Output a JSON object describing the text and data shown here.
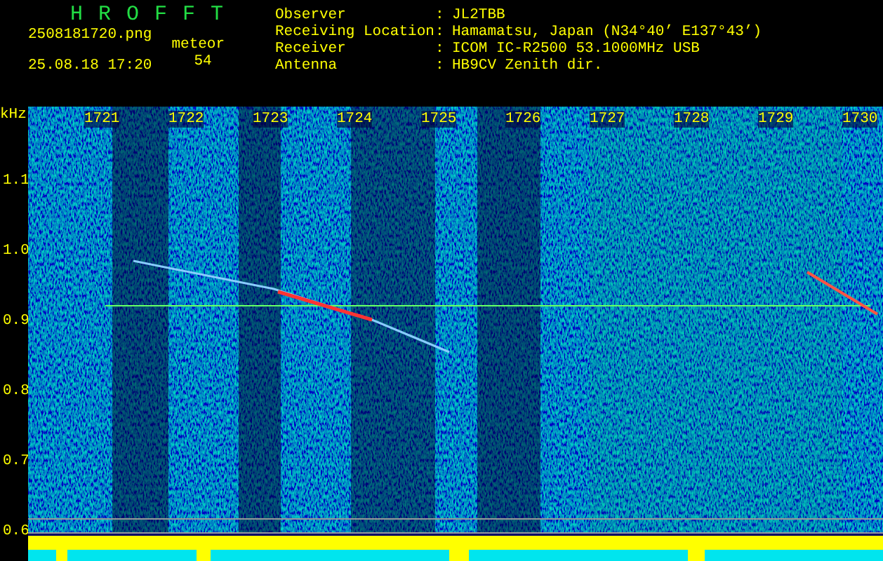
{
  "header": {
    "title": "HROFFT",
    "file": "2508181720.png",
    "datetime": "25.08.18 17:20",
    "meteor_label": "meteor",
    "meteor_count": "54"
  },
  "station": [
    {
      "label": "Observer",
      "separator": ":",
      "value": "JL2TBB"
    },
    {
      "label": "Receiving Location",
      "separator": ":",
      "value": "Hamamatsu, Japan (N34°40’ E137°43’)"
    },
    {
      "label": "Receiver",
      "separator": ":",
      "value": "ICOM IC-R2500 53.1000MHz USB"
    },
    {
      "label": "Antenna",
      "separator": ":",
      "value": "HB9CV Zenith dir."
    }
  ],
  "spectrogram": {
    "unit": "kHz",
    "x_labels": [
      "1721",
      "1722",
      "1723",
      "1724",
      "1725",
      "1726",
      "1727",
      "1728",
      "1729",
      "1730"
    ],
    "y_labels": [
      "1.1",
      "1.0",
      "0.9",
      "0.8",
      "0.7",
      "0.6"
    ]
  }
}
